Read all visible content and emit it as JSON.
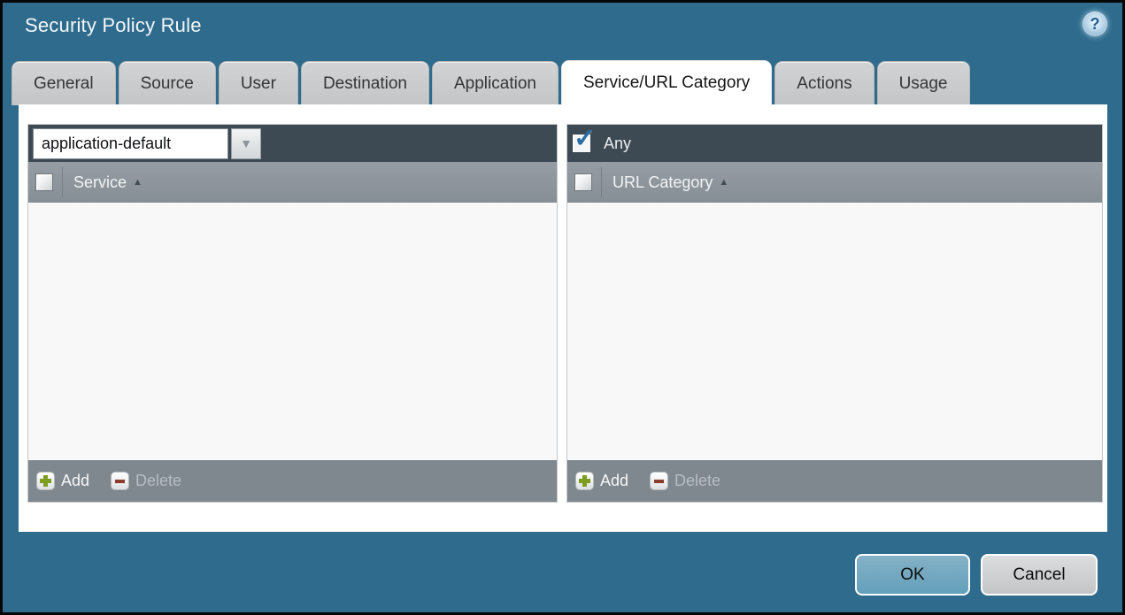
{
  "window": {
    "title": "Security Policy Rule"
  },
  "icons": {
    "help_glyph": "?",
    "chevron_down": "▼",
    "sort_ascending": "▲",
    "check": "✓"
  },
  "tabs": [
    {
      "label": "General",
      "active": false
    },
    {
      "label": "Source",
      "active": false
    },
    {
      "label": "User",
      "active": false
    },
    {
      "label": "Destination",
      "active": false
    },
    {
      "label": "Application",
      "active": false
    },
    {
      "label": "Service/URL Category",
      "active": true
    },
    {
      "label": "Actions",
      "active": false
    },
    {
      "label": "Usage",
      "active": false
    }
  ],
  "service_panel": {
    "dropdown": {
      "value": "application-default"
    },
    "header": {
      "label": "Service",
      "sort": "ascending"
    },
    "rows": [],
    "footer": {
      "add_label": "Add",
      "delete_label": "Delete",
      "delete_enabled": false
    }
  },
  "url_category_panel": {
    "any": {
      "label": "Any",
      "checked": true
    },
    "header": {
      "label": "URL Category",
      "sort": "ascending"
    },
    "rows": [],
    "footer": {
      "add_label": "Add",
      "delete_label": "Delete",
      "delete_enabled": false
    }
  },
  "buttons": {
    "ok": "OK",
    "cancel": "Cancel"
  },
  "colors": {
    "dialog_background": "#2e6b8c",
    "panel_toolbar": "#3d4a54",
    "panel_header": "#8a9198",
    "panel_footer": "#7f878f",
    "ok_button": "#6ba4bd",
    "cancel_button": "#cbcccd",
    "add_icon_green": "#7e9d20",
    "delete_icon_red": "#8c3b2c",
    "check_blue": "#2a6da4"
  }
}
